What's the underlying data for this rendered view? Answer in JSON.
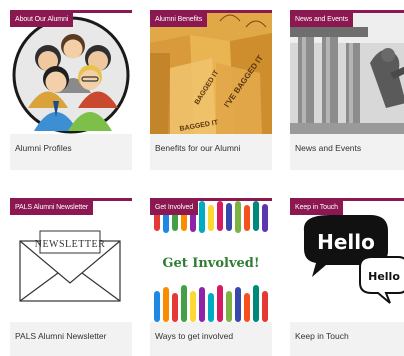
{
  "cards": [
    {
      "tag": "About Our Alumni",
      "label": "Alumni Profiles",
      "icon": "alumni-people-illustration"
    },
    {
      "tag": "Alumni Benefits",
      "label": "Benefits for our Alumni",
      "icon": "shopping-bags-photo",
      "bag_texts": [
        "I'VE BAGGED IT",
        "BAGGED IT",
        "BAGGED IT"
      ]
    },
    {
      "tag": "News and Events",
      "label": "News and Events",
      "icon": "statue-columns-photo"
    },
    {
      "tag": "PALS Alumni Newsletter",
      "label": "PALS Alumni Newsletter",
      "icon": "envelope-newsletter-drawing",
      "envelope_text": "NEWSLETTER"
    },
    {
      "tag": "Get Involved",
      "label": "Ways to get involved",
      "icon": "raised-hands-illustration",
      "banner_text": "Get Involved!"
    },
    {
      "tag": "Keep in Touch",
      "label": "Keep in Touch",
      "icon": "hello-speech-bubbles",
      "bubble_big": "Hello",
      "bubble_small": "Hello"
    }
  ],
  "colors": {
    "accent": "#8b1850",
    "card_bg": "#f2f2f2"
  }
}
